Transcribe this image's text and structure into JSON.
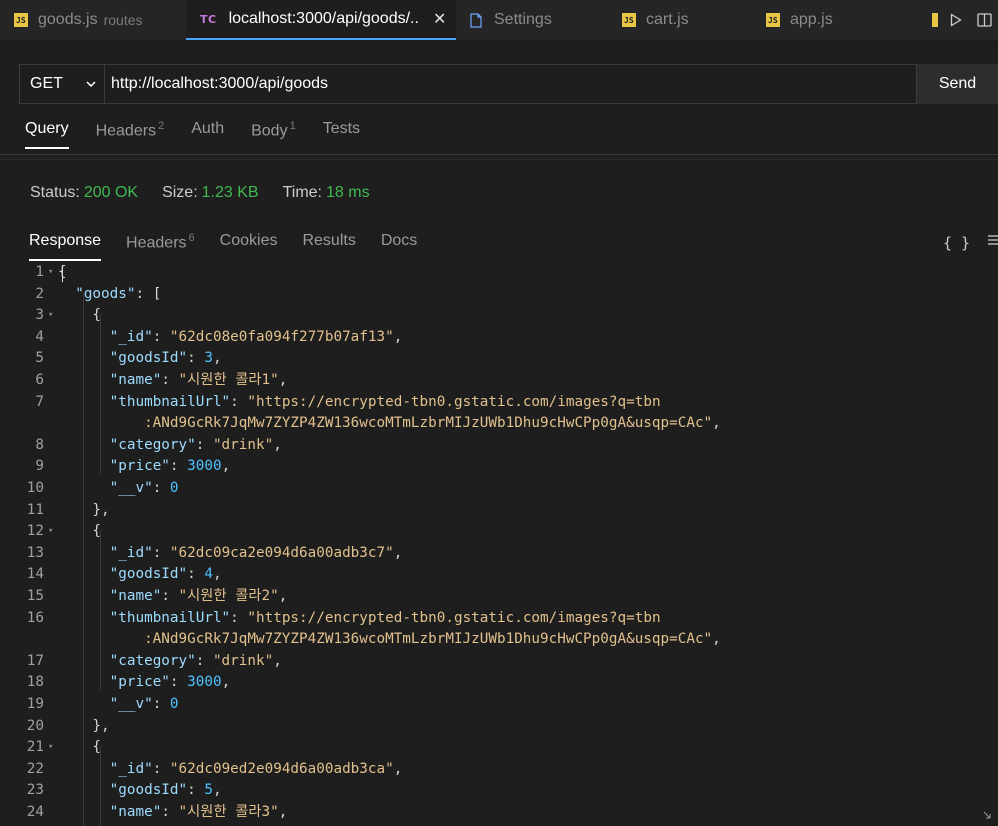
{
  "tabs": [
    {
      "label": "goods.js",
      "sub": "routes",
      "icon": "js-icon"
    },
    {
      "label": "localhost:3000/api/goods/..",
      "icon": "thunder-client-icon"
    },
    {
      "label": "Settings",
      "icon": "file-icon"
    },
    {
      "label": "cart.js",
      "icon": "js-icon"
    },
    {
      "label": "app.js",
      "icon": "js-icon"
    }
  ],
  "request": {
    "method": "GET",
    "url": "http://localhost:3000/api/goods",
    "send_label": "Send"
  },
  "request_tabs": [
    {
      "label": "Query"
    },
    {
      "label": "Headers",
      "count": "2"
    },
    {
      "label": "Auth"
    },
    {
      "label": "Body",
      "count": "1"
    },
    {
      "label": "Tests"
    }
  ],
  "status": {
    "status_label": "Status:",
    "status_value": "200 OK",
    "size_label": "Size:",
    "size_value": "1.23 KB",
    "time_label": "Time:",
    "time_value": "18 ms",
    "color_ok": "#3fb950"
  },
  "response_tabs": [
    {
      "label": "Response"
    },
    {
      "label": "Headers",
      "count": "6"
    },
    {
      "label": "Cookies"
    },
    {
      "label": "Results"
    },
    {
      "label": "Docs"
    }
  ],
  "format_label": "{ }",
  "code_lines": [
    {
      "n": "1",
      "fold": true,
      "segs": [
        [
          "p",
          "{"
        ]
      ]
    },
    {
      "n": "2",
      "segs": [
        [
          "p",
          "  "
        ],
        [
          "k",
          "\"goods\""
        ],
        [
          "p",
          ": ["
        ]
      ]
    },
    {
      "n": "3",
      "fold": true,
      "segs": [
        [
          "p",
          "    {"
        ]
      ]
    },
    {
      "n": "4",
      "segs": [
        [
          "p",
          "      "
        ],
        [
          "k",
          "\"_id\""
        ],
        [
          "p",
          ": "
        ],
        [
          "s",
          "\"62dc08e0fa094f277b07af13\""
        ],
        [
          "p",
          ","
        ]
      ]
    },
    {
      "n": "5",
      "segs": [
        [
          "p",
          "      "
        ],
        [
          "k",
          "\"goodsId\""
        ],
        [
          "p",
          ": "
        ],
        [
          "n",
          "3"
        ],
        [
          "p",
          ","
        ]
      ]
    },
    {
      "n": "6",
      "segs": [
        [
          "p",
          "      "
        ],
        [
          "k",
          "\"name\""
        ],
        [
          "p",
          ": "
        ],
        [
          "s",
          "\"시원한 콜라1\""
        ],
        [
          "p",
          ","
        ]
      ]
    },
    {
      "n": "7",
      "segs": [
        [
          "p",
          "      "
        ],
        [
          "k",
          "\"thumbnailUrl\""
        ],
        [
          "p",
          ": "
        ],
        [
          "s",
          "\"https://encrypted-tbn0.gstatic.com/images?q=tbn"
        ]
      ]
    },
    {
      "n": "",
      "segs": [
        [
          "s",
          "          :ANd9GcRk7JqMw7ZYZP4ZW136wcoMTmLzbrMIJzUWb1Dhu9cHwCPp0gA&usqp=CAc\""
        ],
        [
          "p",
          ","
        ]
      ]
    },
    {
      "n": "8",
      "segs": [
        [
          "p",
          "      "
        ],
        [
          "k",
          "\"category\""
        ],
        [
          "p",
          ": "
        ],
        [
          "s",
          "\"drink\""
        ],
        [
          "p",
          ","
        ]
      ]
    },
    {
      "n": "9",
      "segs": [
        [
          "p",
          "      "
        ],
        [
          "k",
          "\"price\""
        ],
        [
          "p",
          ": "
        ],
        [
          "n",
          "3000"
        ],
        [
          "p",
          ","
        ]
      ]
    },
    {
      "n": "10",
      "segs": [
        [
          "p",
          "      "
        ],
        [
          "k",
          "\"__v\""
        ],
        [
          "p",
          ": "
        ],
        [
          "n",
          "0"
        ]
      ]
    },
    {
      "n": "11",
      "segs": [
        [
          "p",
          "    },"
        ]
      ]
    },
    {
      "n": "12",
      "fold": true,
      "segs": [
        [
          "p",
          "    {"
        ]
      ]
    },
    {
      "n": "13",
      "segs": [
        [
          "p",
          "      "
        ],
        [
          "k",
          "\"_id\""
        ],
        [
          "p",
          ": "
        ],
        [
          "s",
          "\"62dc09ca2e094d6a00adb3c7\""
        ],
        [
          "p",
          ","
        ]
      ]
    },
    {
      "n": "14",
      "segs": [
        [
          "p",
          "      "
        ],
        [
          "k",
          "\"goodsId\""
        ],
        [
          "p",
          ": "
        ],
        [
          "n",
          "4"
        ],
        [
          "p",
          ","
        ]
      ]
    },
    {
      "n": "15",
      "segs": [
        [
          "p",
          "      "
        ],
        [
          "k",
          "\"name\""
        ],
        [
          "p",
          ": "
        ],
        [
          "s",
          "\"시원한 콜라2\""
        ],
        [
          "p",
          ","
        ]
      ]
    },
    {
      "n": "16",
      "segs": [
        [
          "p",
          "      "
        ],
        [
          "k",
          "\"thumbnailUrl\""
        ],
        [
          "p",
          ": "
        ],
        [
          "s",
          "\"https://encrypted-tbn0.gstatic.com/images?q=tbn"
        ]
      ]
    },
    {
      "n": "",
      "segs": [
        [
          "s",
          "          :ANd9GcRk7JqMw7ZYZP4ZW136wcoMTmLzbrMIJzUWb1Dhu9cHwCPp0gA&usqp=CAc\""
        ],
        [
          "p",
          ","
        ]
      ]
    },
    {
      "n": "17",
      "segs": [
        [
          "p",
          "      "
        ],
        [
          "k",
          "\"category\""
        ],
        [
          "p",
          ": "
        ],
        [
          "s",
          "\"drink\""
        ],
        [
          "p",
          ","
        ]
      ]
    },
    {
      "n": "18",
      "segs": [
        [
          "p",
          "      "
        ],
        [
          "k",
          "\"price\""
        ],
        [
          "p",
          ": "
        ],
        [
          "n",
          "3000"
        ],
        [
          "p",
          ","
        ]
      ]
    },
    {
      "n": "19",
      "segs": [
        [
          "p",
          "      "
        ],
        [
          "k",
          "\"__v\""
        ],
        [
          "p",
          ": "
        ],
        [
          "n",
          "0"
        ]
      ]
    },
    {
      "n": "20",
      "segs": [
        [
          "p",
          "    },"
        ]
      ]
    },
    {
      "n": "21",
      "fold": true,
      "segs": [
        [
          "p",
          "    {"
        ]
      ]
    },
    {
      "n": "22",
      "segs": [
        [
          "p",
          "      "
        ],
        [
          "k",
          "\"_id\""
        ],
        [
          "p",
          ": "
        ],
        [
          "s",
          "\"62dc09ed2e094d6a00adb3ca\""
        ],
        [
          "p",
          ","
        ]
      ]
    },
    {
      "n": "23",
      "segs": [
        [
          "p",
          "      "
        ],
        [
          "k",
          "\"goodsId\""
        ],
        [
          "p",
          ": "
        ],
        [
          "n",
          "5"
        ],
        [
          "p",
          ","
        ]
      ]
    },
    {
      "n": "24",
      "segs": [
        [
          "p",
          "      "
        ],
        [
          "k",
          "\"name\""
        ],
        [
          "p",
          ": "
        ],
        [
          "s",
          "\"시원한 콜라3\""
        ],
        [
          "p",
          ","
        ]
      ]
    }
  ]
}
